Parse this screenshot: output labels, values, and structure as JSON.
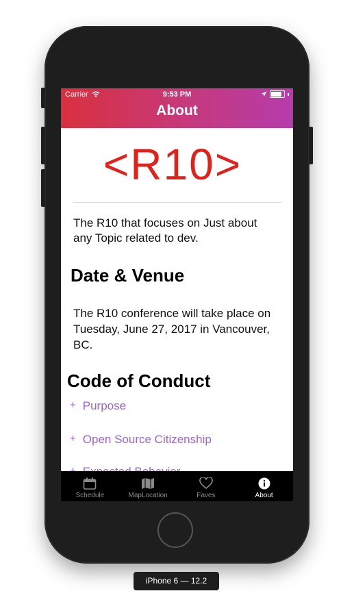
{
  "status_bar": {
    "carrier": "Carrier",
    "time": "9:53 PM"
  },
  "header": {
    "title": "About"
  },
  "logo_text": "<R10>",
  "intro": "The R10 that focuses on Just about any Topic related to dev.",
  "date_venue": {
    "heading": "Date & Venue",
    "body": "The R10 conference will take place on Tuesday, June 27, 2017 in Vancouver, BC."
  },
  "code_of_conduct": {
    "heading": "Code of Conduct",
    "items": [
      {
        "label": "Purpose",
        "toggle": "+"
      },
      {
        "label": "Open Source Citizenship",
        "toggle": "+"
      },
      {
        "label": "Expected Behavior",
        "toggle": "+"
      }
    ]
  },
  "tabs": [
    {
      "label": "Schedule",
      "icon": "calendar-icon",
      "active": false
    },
    {
      "label": "MapLocation",
      "icon": "map-icon",
      "active": false
    },
    {
      "label": "Faves",
      "icon": "heart-icon",
      "active": false
    },
    {
      "label": "About",
      "icon": "info-icon",
      "active": true
    }
  ],
  "device_label": "iPhone 6 — 12.2",
  "colors": {
    "header_gradient": [
      "#d9303f",
      "#b53cac"
    ],
    "logo": "#e0221b",
    "accent_link": "#9a63d2",
    "tabbar_bg": "#000000"
  }
}
